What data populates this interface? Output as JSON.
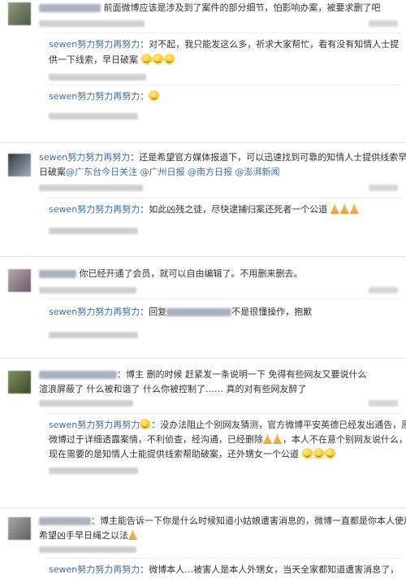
{
  "comments": [
    {
      "text": "前面微博应该是涉及到了案件的部分细节，怕影响办案，被要求删了吧",
      "replies": [
        {
          "name": "sewen努力努力再努力",
          "text_1": "：对不起，我只能发这么多，祈求大家帮忙，看有没有知情人士提",
          "text_2": "供一下线索，早日破案"
        },
        {
          "name": "sewen努力努力再努力",
          "text_1": "："
        }
      ]
    },
    {
      "name": "sewen努力努力再努力",
      "text_1": "：还是希望官方媒体报道下，可以迅速找到可靠的知情人士提供线索早",
      "text_2a": "日破案",
      "mentions": [
        "@广东台今日关注",
        "@广州日报",
        "@南方日报",
        "@澎湃新闻"
      ],
      "replies": [
        {
          "name": "sewen努力努力再努力",
          "text_1": "：如此凶残之徒，尽快逮捕归案还死者一个公道"
        }
      ]
    },
    {
      "text": "你已经开通了会员，就可以自由编辑了。不用删来删去。",
      "replies": [
        {
          "name": "sewen努力努力再努力",
          "text_1": "：回复",
          "text_2": "不是很懂操作，抱歉"
        }
      ]
    },
    {
      "text_1": "：博主 删的时候 赶紧发一条说明一下 免得有些网友又要说什么",
      "text_2": "渲浪屏蔽了 什么被和谐了 什么你被控制了……   真的对有些网友醉了",
      "replies": [
        {
          "name": "sewen努力努力再努力",
          "text_1": "：没办法阻止个别网友猜测，官方微博平安英德已经发出通告，原",
          "text_2": "微博过于详细透露案情，不利侦查，经沟通，已经删除",
          "text_2b": "，本人不在意个别网友说什么，我",
          "text_3": "现在需要的是知情人士能提供线索帮助破案，还外甥女一个公道"
        }
      ]
    },
    {
      "text_1": "：博主能告诉一下你是什么时候知道小姑娘遭害消息的，微博一直都是你本人使用吗?",
      "text_2": "希望凶手早日绳之以法",
      "replies": [
        {
          "name": "sewen努力努力再努力",
          "text_1": "：微博本人…被害人是本人外甥女，当天全家都知道遭害消息了，"
        }
      ]
    }
  ]
}
